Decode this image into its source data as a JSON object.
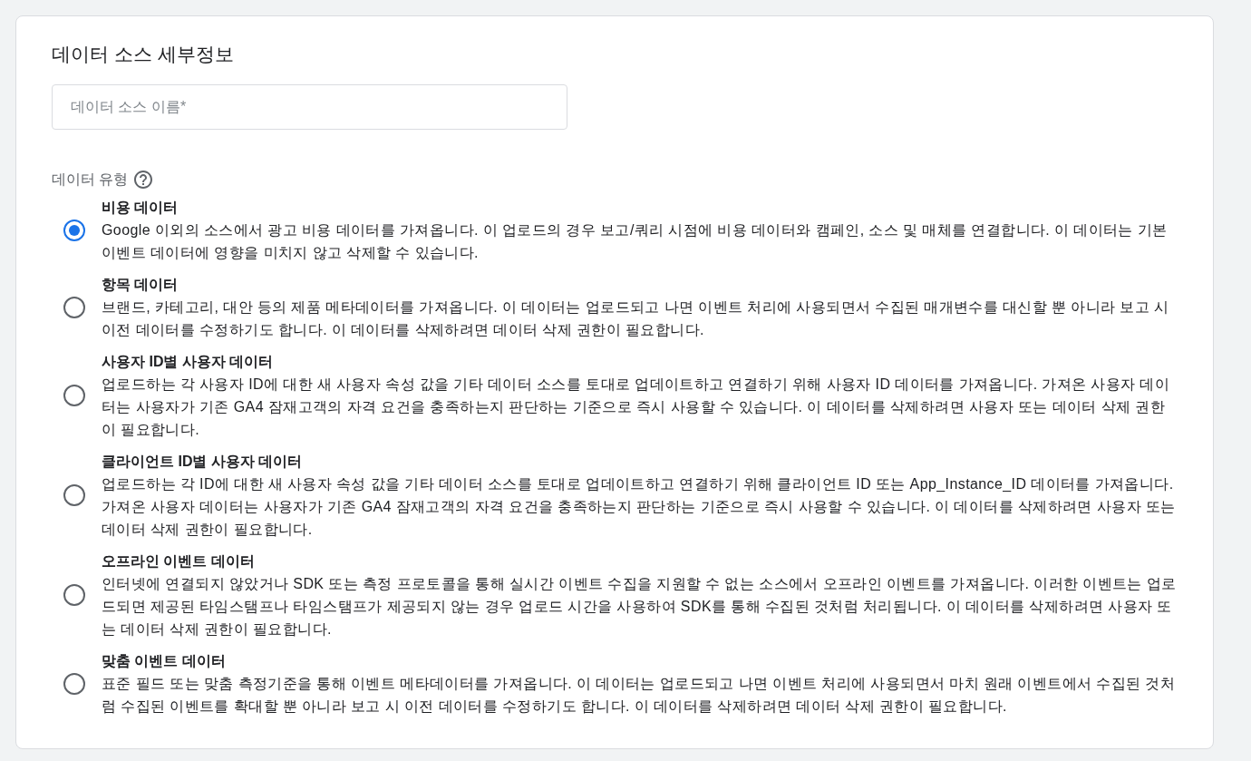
{
  "card": {
    "title": "데이터 소스 세부정보",
    "name_field": {
      "placeholder": "데이터 소스 이름*"
    },
    "data_type": {
      "label": "데이터 유형",
      "options": [
        {
          "title": "비용 데이터",
          "description": "Google 이외의 소스에서 광고 비용 데이터를 가져옵니다. 이 업로드의 경우 보고/쿼리 시점에 비용 데이터와 캠페인, 소스 및 매체를 연결합니다. 이 데이터는 기본 이벤트 데이터에 영향을 미치지 않고 삭제할 수 있습니다.",
          "selected": true
        },
        {
          "title": "항목 데이터",
          "description": "브랜드, 카테고리, 대안 등의 제품 메타데이터를 가져옵니다. 이 데이터는 업로드되고 나면 이벤트 처리에 사용되면서 수집된 매개변수를 대신할 뿐 아니라 보고 시 이전 데이터를 수정하기도 합니다. 이 데이터를 삭제하려면 데이터 삭제 권한이 필요합니다.",
          "selected": false
        },
        {
          "title": "사용자 ID별 사용자 데이터",
          "description": "업로드하는 각 사용자 ID에 대한 새 사용자 속성 값을 기타 데이터 소스를 토대로 업데이트하고 연결하기 위해 사용자 ID 데이터를 가져옵니다. 가져온 사용자 데이터는 사용자가 기존 GA4 잠재고객의 자격 요건을 충족하는지 판단하는 기준으로 즉시 사용할 수 있습니다. 이 데이터를 삭제하려면 사용자 또는 데이터 삭제 권한이 필요합니다.",
          "selected": false
        },
        {
          "title": "클라이언트 ID별 사용자 데이터",
          "description": "업로드하는 각 ID에 대한 새 사용자 속성 값을 기타 데이터 소스를 토대로 업데이트하고 연결하기 위해 클라이언트 ID 또는 App_Instance_ID 데이터를 가져옵니다. 가져온 사용자 데이터는 사용자가 기존 GA4 잠재고객의 자격 요건을 충족하는지 판단하는 기준으로 즉시 사용할 수 있습니다. 이 데이터를 삭제하려면 사용자 또는 데이터 삭제 권한이 필요합니다.",
          "selected": false
        },
        {
          "title": "오프라인 이벤트 데이터",
          "description": "인터넷에 연결되지 않았거나 SDK 또는 측정 프로토콜을 통해 실시간 이벤트 수집을 지원할 수 없는 소스에서 오프라인 이벤트를 가져옵니다. 이러한 이벤트는 업로드되면 제공된 타임스탬프나 타임스탬프가 제공되지 않는 경우 업로드 시간을 사용하여 SDK를 통해 수집된 것처럼 처리됩니다. 이 데이터를 삭제하려면 사용자 또는 데이터 삭제 권한이 필요합니다.",
          "selected": false
        },
        {
          "title": "맞춤 이벤트 데이터",
          "description": "표준 필드 또는 맞춤 측정기준을 통해 이벤트 메타데이터를 가져옵니다. 이 데이터는 업로드되고 나면 이벤트 처리에 사용되면서 마치 원래 이벤트에서 수집된 것처럼 수집된 이벤트를 확대할 뿐 아니라 보고 시 이전 데이터를 수정하기도 합니다. 이 데이터를 삭제하려면 데이터 삭제 권한이 필요합니다.",
          "selected": false
        }
      ]
    }
  }
}
